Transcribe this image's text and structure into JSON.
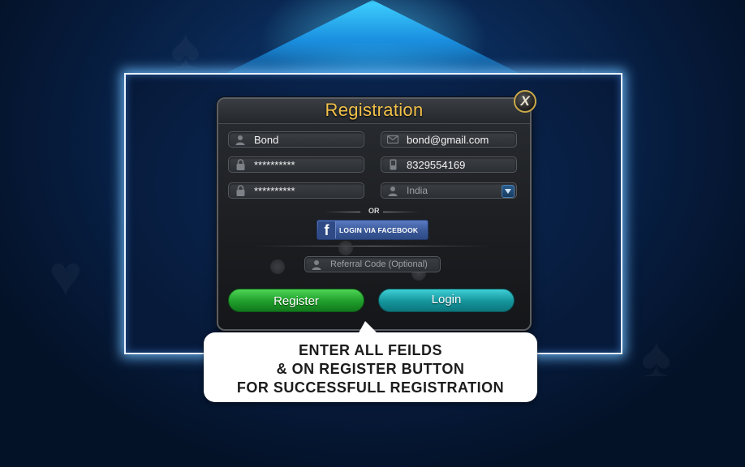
{
  "dialog": {
    "title": "Registration",
    "close_label": "X"
  },
  "form": {
    "name_value": "Bond",
    "email_value": "bond@gmail.com",
    "password_value": "**********",
    "phone_value": "8329554169",
    "confirm_password_value": "**********",
    "country_value": "India",
    "or_label": "OR",
    "facebook_label": "LOGIN VIA FACEBOOK",
    "facebook_logo": "f",
    "referral_placeholder": "Referral Code (Optional)"
  },
  "actions": {
    "register_label": "Register",
    "login_label": "Login"
  },
  "callout": {
    "line1": "ENTER ALL FEILDS",
    "line2": "& ON REGISTER BUTTON",
    "line3": "FOR SUCCESSFULL REGISTRATION"
  },
  "icons": {
    "user": "user-icon",
    "mail": "mail-icon",
    "lock": "lock-icon",
    "phone": "phone-icon",
    "dropdown": "chevron-down-icon"
  },
  "colors": {
    "title": "#f2c14a",
    "register": "#1f9e2b",
    "login": "#14949b",
    "facebook": "#3b5998"
  }
}
